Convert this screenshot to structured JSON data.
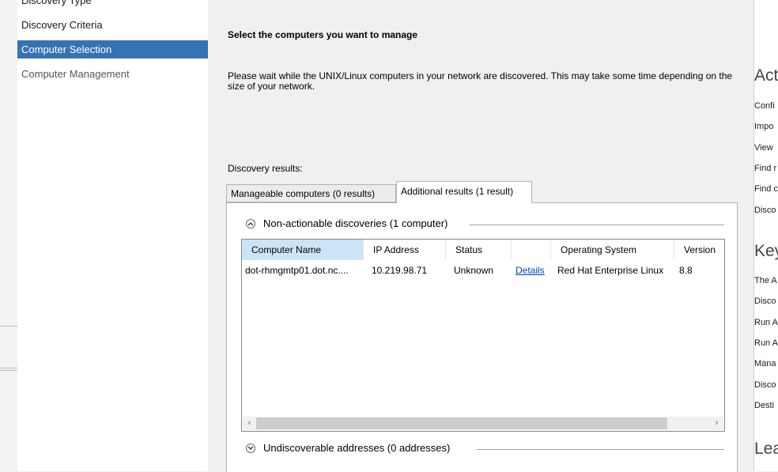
{
  "nav": {
    "items": [
      {
        "label": "Discovery Type",
        "state": "normal"
      },
      {
        "label": "Discovery Criteria",
        "state": "normal"
      },
      {
        "label": "Computer Selection",
        "state": "selected"
      },
      {
        "label": "Computer Management",
        "state": "dim"
      }
    ]
  },
  "main": {
    "heading": "Select the computers you want to manage",
    "wait_text": "Please wait while the UNIX/Linux computers in your network are discovered. This may take some time depending on the size of your network.",
    "discovery_label": "Discovery results:",
    "tabs": {
      "manageable": "Manageable computers (0 results)",
      "additional": "Additional results (1 result)"
    },
    "groups": {
      "non_actionable": "Non-actionable discoveries (1 computer)",
      "undiscoverable": "Undiscoverable addresses (0 addresses)"
    },
    "table": {
      "headers": {
        "computer_name": "Computer Name",
        "ip_address": "IP Address",
        "status": "Status",
        "details": "",
        "operating_system": "Operating System",
        "version": "Version"
      },
      "rows": [
        {
          "computer_name": "dot-rhmgmtp01.dot.nc....",
          "ip_address": "10.219.98.71",
          "status": "Unknown",
          "details": "Details",
          "operating_system": "Red Hat Enterprise Linux",
          "version": "8.8"
        }
      ]
    },
    "scroll": {
      "left": "‹",
      "right": "›"
    }
  },
  "right_panel": {
    "actions_heading": "Act",
    "actions": [
      "Confi",
      "Impo",
      "View",
      "Find r",
      "Find c",
      "Disco"
    ],
    "key_heading": "Key",
    "key_items": [
      "The A",
      "Disco",
      "Run A",
      "Run A",
      "Mana",
      "Disco",
      "Desti"
    ],
    "learn_heading": "Lea"
  },
  "colors": {
    "selected_nav": "#3673b4",
    "selected_header": "#cce4f7",
    "link": "#0645ad"
  }
}
